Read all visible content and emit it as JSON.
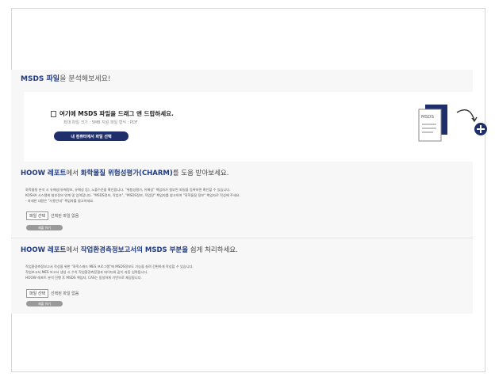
{
  "intro": {
    "highlight": "MSDS 파일",
    "rest": "을 분석해보세요!"
  },
  "dropzone": {
    "title": "여기에 MSDS 파일을 드래그 앤 드랍하세요.",
    "note": "최대 파일 크기 : 5MB    지원 파일 형식 : PDF",
    "button_label": "내 컴퓨터에서 파일 선택",
    "doc_label": "MSDS"
  },
  "section1": {
    "title_hl1": "HOOW 레포트",
    "title_mid": "에서 ",
    "title_hl2": "화학물질 위험성평가(CHARM)",
    "title_rest": "를 도움 받아보세요.",
    "body_lines": [
      "화학물질 분석 시 유해성(유해정보, 유해성 등), 노출수준을 확인합니다. \"위험성평가, 유해성\" 책임자가 첨부된 파일을 등록하면 확인할 수 있습니다.",
      "KOSHA 시스템에 첨부정보 연계 및 입력합니다. \"MSDS정보, 작업조\", \"MSDS정보, 작업장\" 책임자를 참고하여 \"화학물질 정보\" 책임자로 작성해 주세요.",
      "- 자세한 내용은 \"사용안내\" 책임자를 참고하세요."
    ],
    "file_button": "파일 선택",
    "file_status": "선택된 파일 없음",
    "run_label": "제출 하기"
  },
  "section2": {
    "title_hl1": "HOOW 레포트",
    "title_mid": "에서 ",
    "title_hl2": "작업환경측정보고서의 MSDS 부분을",
    "title_rest": " 쉽게 처리하세요.",
    "body_lines": [
      "작업환경측정보고서 작성을 위한 \"화학스캐드 MES 프로그램\"에 MSDS정보도 기능을 살려 간편하게 작성할 수 있습니다.",
      "작업보고서 MES 보고서 생성 시 수치 작업환경측정결과 데이터와 값이 자동 입력됩니다.",
      "HOOW 레포트 분석 진행 후 MSDS 책임자, CAS는 동일하게 기반으로 제공됩니다."
    ],
    "file_button": "파일 선택",
    "file_status": "선택된 파일 없음",
    "run_label": "제출 하기"
  }
}
